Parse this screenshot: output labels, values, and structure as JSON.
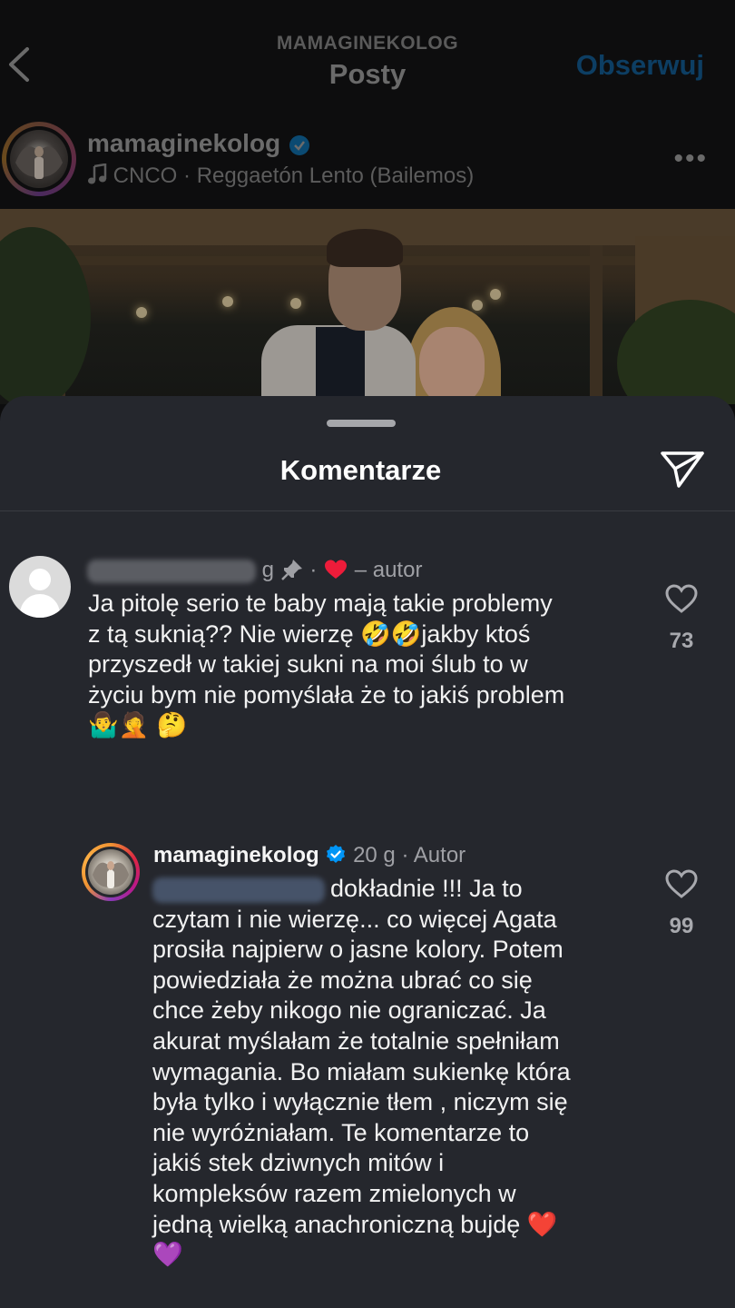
{
  "header": {
    "subtitle": "MAMAGINEKOLOG",
    "title": "Posty",
    "follow_label": "Obserwuj"
  },
  "post": {
    "username": "mamaginekolog",
    "music_artist": "CNCO",
    "music_separator": "·",
    "music_track": "Reggaetón Lento (Bailemos)"
  },
  "comments_sheet": {
    "title": "Komentarze"
  },
  "comments": [
    {
      "time": "g",
      "author_tag": "– autor",
      "text_lines": [
        "Ja pitolę serio te baby mają takie problemy",
        "z tą suknią?? Nie wierzę 🤣🤣jakby ktoś",
        "przyszedł w takiej sukni na moi ślub to w",
        "życiu bym nie pomyślała że to jakiś problem",
        "🤷‍♂️🤦 🤔"
      ],
      "likes": "73"
    },
    {
      "username": "mamaginekolog",
      "time": "20 g",
      "author_tag": "· Autor",
      "text_first": "dokładnie !!! Ja to",
      "text_lines": [
        "czytam i nie wierzę... co więcej Agata",
        "prosiła najpierw o jasne kolory. Potem",
        "powiedziała że można ubrać co się",
        "chce żeby nikogo nie ograniczać. Ja",
        "akurat myślałam że totalnie spełniłam",
        "wymagania. Bo miałam sukienkę która",
        "była tylko i wyłącznie tłem , niczym się",
        "nie wyróżniałam. Te komentarze to",
        "jakiś stek dziwnych mitów i",
        "kompleksów razem zmielonych w",
        "jedną wielką anachroniczną bujdę ❤️",
        "💜"
      ],
      "likes": "99"
    }
  ],
  "colors": {
    "sheet_bg": "#25272d",
    "heart_red": "#ed1c3a",
    "verified_blue": "#0095f6",
    "follow_dim": "#0d3e63"
  },
  "icons": {
    "back": "chevron-left-icon",
    "verified": "verified-badge-icon",
    "music": "music-note-icon",
    "more": "more-horizontal-icon",
    "share": "paper-plane-icon",
    "pin": "pin-icon",
    "like": "heart-outline-icon",
    "liked_by_author": "heart-filled-icon"
  }
}
